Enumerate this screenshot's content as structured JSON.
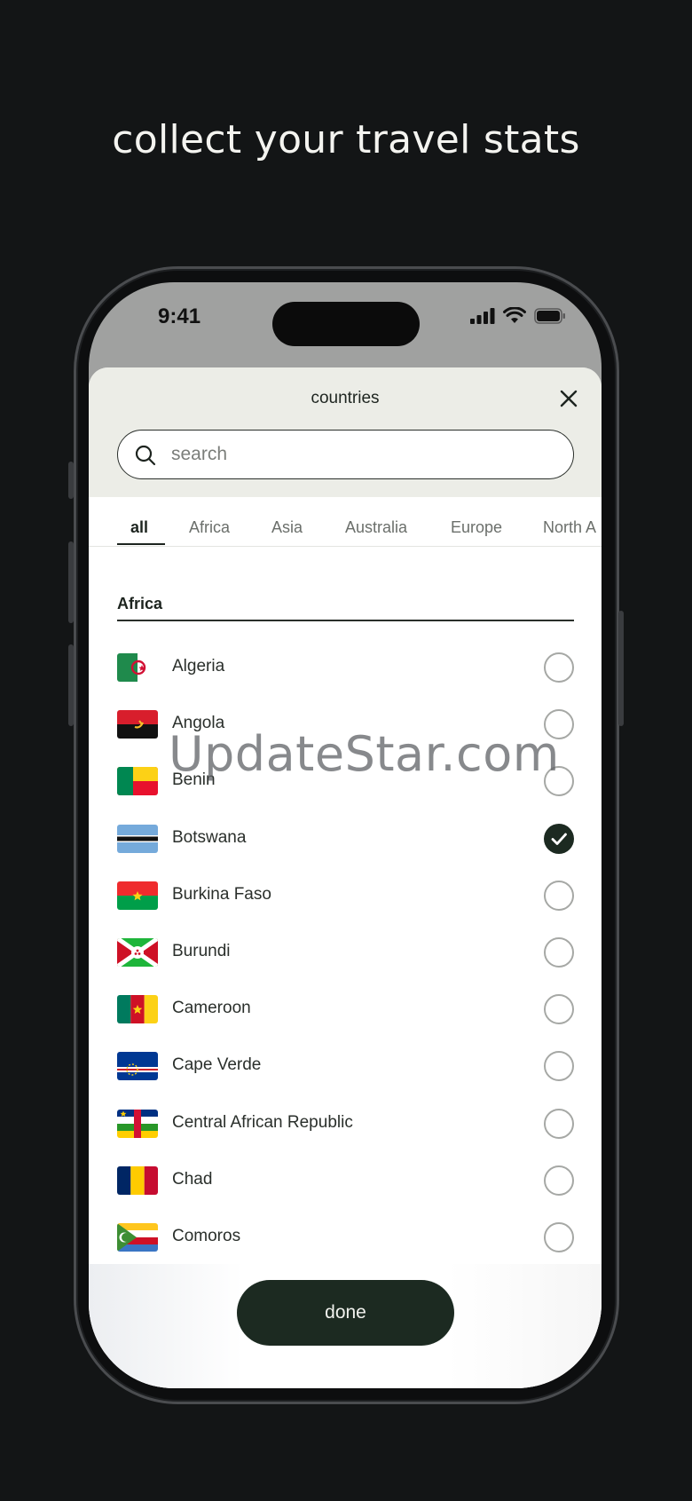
{
  "headline": "collect your travel stats",
  "status_bar": {
    "time": "9:41"
  },
  "sheet": {
    "title": "countries",
    "search_placeholder": "search",
    "tabs": [
      "all",
      "Africa",
      "Asia",
      "Australia",
      "Europe",
      "North A"
    ],
    "active_tab": "all",
    "section_title": "Africa",
    "countries": [
      {
        "name": "Algeria",
        "selected": false
      },
      {
        "name": "Angola",
        "selected": false
      },
      {
        "name": "Benin",
        "selected": false
      },
      {
        "name": "Botswana",
        "selected": true
      },
      {
        "name": "Burkina Faso",
        "selected": false
      },
      {
        "name": "Burundi",
        "selected": false
      },
      {
        "name": "Cameroon",
        "selected": false
      },
      {
        "name": "Cape Verde",
        "selected": false
      },
      {
        "name": "Central African Republic",
        "selected": false
      },
      {
        "name": "Chad",
        "selected": false
      },
      {
        "name": "Comoros",
        "selected": false
      }
    ],
    "done_label": "done"
  },
  "watermark": "UpdateStar.com",
  "colors": {
    "background": "#131516",
    "accent": "#1c2a21",
    "sheet_header": "#ecede7"
  }
}
